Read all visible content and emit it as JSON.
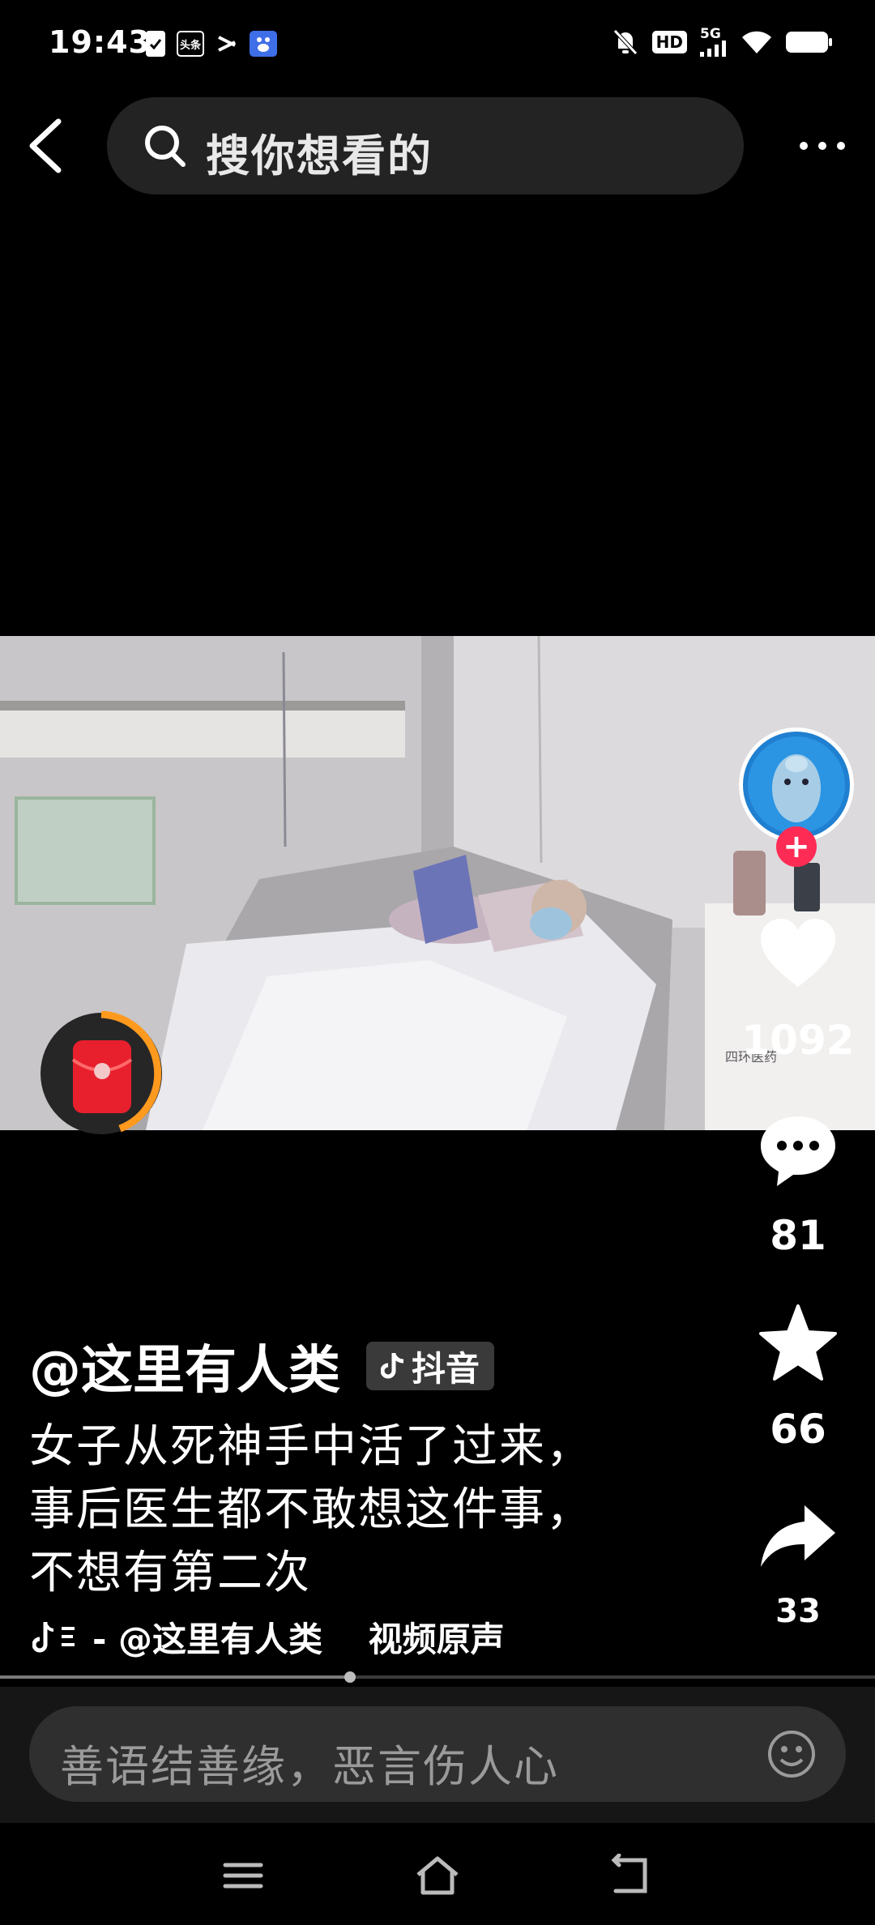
{
  "status_bar": {
    "time": "19:43",
    "left_icons": [
      "check-clipboard-icon",
      "toutiao-app-icon",
      "capcut-app-icon",
      "baidu-app-icon"
    ],
    "app_label_toutiao": "头条",
    "right_icons": [
      "mute-bell-icon",
      "hd-icon",
      "signal-5g-icon",
      "wifi-icon",
      "battery-icon"
    ],
    "hd_label": "HD",
    "network_label": "5G"
  },
  "top_bar": {
    "search_placeholder": "搜你想看的"
  },
  "video": {
    "watermark": "四环医药"
  },
  "right_rail": {
    "like_count": "1092",
    "comment_count": "81",
    "favorite_count": "66",
    "share_count": "33",
    "follow_symbol": "+"
  },
  "post": {
    "author": "@这里有人类",
    "brand_tag": "抖音",
    "caption_lines": [
      "女子从死神手中活了过来，",
      "事后医生都不敢想这件事，",
      "不想有第二次"
    ],
    "music_text": "- @这里有人类　 视频原声"
  },
  "progress": {
    "fraction": 0.4
  },
  "comment_bar": {
    "placeholder": "善语结善缘，恶言伤人心"
  },
  "colors": {
    "accent_red": "#fe2c55",
    "background": "#000000",
    "input_bg": "#2f2f2f"
  }
}
